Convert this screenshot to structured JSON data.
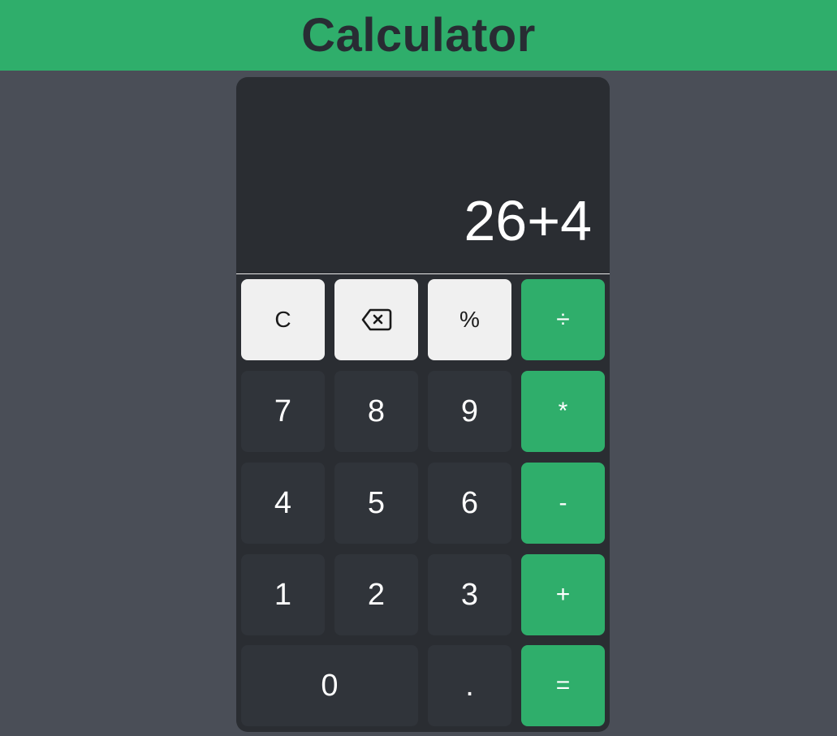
{
  "header": {
    "title": "Calculator"
  },
  "display": {
    "value": "26+4"
  },
  "keys": {
    "clear": "C",
    "backspace_icon": "backspace-icon",
    "percent": "%",
    "divide": "÷",
    "seven": "7",
    "eight": "8",
    "nine": "9",
    "multiply": "*",
    "four": "4",
    "five": "5",
    "six": "6",
    "subtract": "-",
    "one": "1",
    "two": "2",
    "three": "3",
    "add": "+",
    "zero": "0",
    "decimal": ".",
    "equals": "="
  },
  "colors": {
    "accent": "#2fae6b",
    "background": "#4a4e57",
    "panel": "#2a2d32",
    "key_dark": "#30343a",
    "key_light": "#f0f0f0"
  }
}
